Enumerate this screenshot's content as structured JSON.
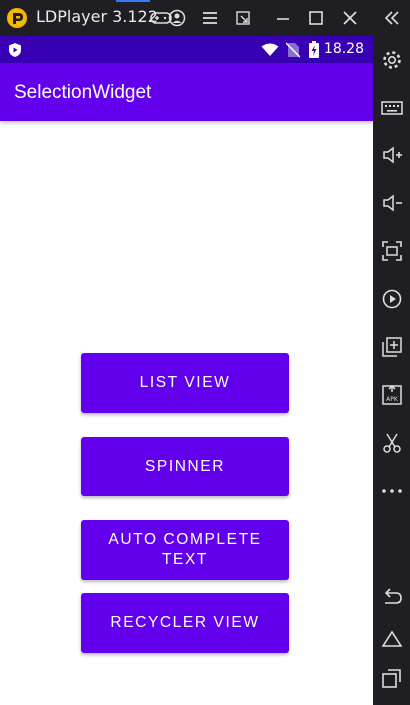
{
  "window": {
    "title": "LDPlayer 3.122"
  },
  "status_bar": {
    "time": "18.28"
  },
  "app_bar": {
    "title": "SelectionWidget"
  },
  "buttons": {
    "list_view": "LIST VIEW",
    "spinner": "SPINNER",
    "auto_complete_line1": "AUTO COMPLETE",
    "auto_complete_line2": "TEXT",
    "recycler_view": "RECYCLER VIEW"
  },
  "colors": {
    "primary": "#6200ee",
    "primary_dark": "#3700b3",
    "emulator_chrome": "#1f1f23",
    "logo": "#f5b800"
  },
  "toolbar_icons": [
    "settings-icon",
    "keyboard-icon",
    "volume-up-icon",
    "volume-down-icon",
    "fullscreen-icon",
    "record-icon",
    "multi-instance-icon",
    "apk-install-icon",
    "screenshot-scissors-icon",
    "more-icon",
    "back-icon",
    "home-icon",
    "recent-apps-icon"
  ]
}
